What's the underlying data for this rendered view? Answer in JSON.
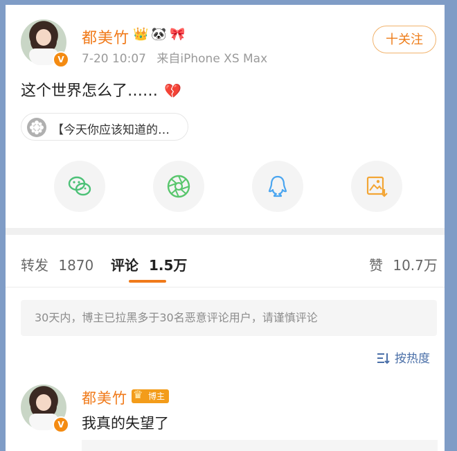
{
  "post": {
    "author": "都美竹",
    "timestamp": "7-20 10:07",
    "source": "来自iPhone XS Max",
    "follow_label": "十关注",
    "text": "这个世界怎么了……",
    "broken_heart_icon": "broken-heart-icon",
    "link_card_label": "【今天你应该知道的…",
    "badges": [
      "crown-icon",
      "panda-icon",
      "gift-icon"
    ]
  },
  "share": {
    "items": [
      {
        "name": "wechat-icon",
        "color": "#4cc177"
      },
      {
        "name": "moments-icon",
        "color": "#58c66c"
      },
      {
        "name": "qq-icon",
        "color": "#4aa5f0"
      },
      {
        "name": "save-image-icon",
        "color": "#f3a534"
      }
    ]
  },
  "tabs": {
    "repost": {
      "label": "转发",
      "count": "1870"
    },
    "comment": {
      "label": "评论",
      "count": "1.5万"
    },
    "like": {
      "label": "赞",
      "count": "10.7万"
    }
  },
  "notice": "30天内，博主已拉黑多于30名恶意评论用户，请谨慎评论",
  "sort_label": "按热度",
  "comment": {
    "author": "都美竹",
    "badge_label": "博主",
    "text": "我真的失望了"
  },
  "colors": {
    "accent": "#f07a1a",
    "link_blue": "#4a6fa8"
  }
}
